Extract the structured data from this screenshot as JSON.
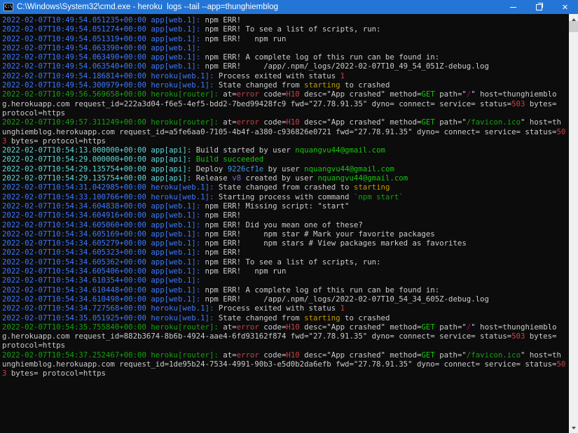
{
  "window": {
    "title": "C:\\Windows\\System32\\cmd.exe - heroku  logs --tail --app=thunghiemblog",
    "icon_text": "C:\\",
    "controls": {
      "minimize": "minimize",
      "restore": "restore-down",
      "close_glyph": "✕"
    }
  },
  "scrollbar": {
    "orientation": "vertical",
    "thumb_position": "top"
  },
  "palette": {
    "titlebar": "#2476D6",
    "background": "#0C0C0C",
    "fg": "#CCCCCC",
    "blue": "#3B78FF",
    "cyan": "#61D6D6",
    "green_dark": "#13A10E",
    "green_bright": "#16C60C",
    "red": "#CD3F45",
    "yellow": "#C19C00",
    "magenta": "#B4009E",
    "violet": "#875FD7",
    "deploy_blue": "#3A96DD",
    "scrollbar_track": "#F0F0F0",
    "scrollbar_thumb": "#CDCDCD"
  },
  "terminal": {
    "lines": [
      [
        [
          "2022-02-07T10:49:54.051235+00:00 ",
          "blue"
        ],
        [
          "app[web.1]:",
          "blue"
        ],
        [
          " npm ERR!",
          "fg"
        ]
      ],
      [
        [
          "2022-02-07T10:49:54.051274+00:00 ",
          "blue"
        ],
        [
          "app[web.1]:",
          "blue"
        ],
        [
          " npm ERR! To see a list of scripts, run:",
          "fg"
        ]
      ],
      [
        [
          "2022-02-07T10:49:54.051319+00:00 ",
          "blue"
        ],
        [
          "app[web.1]:",
          "blue"
        ],
        [
          " npm ERR!   npm run",
          "fg"
        ]
      ],
      [
        [
          "2022-02-07T10:49:54.063390+00:00 ",
          "blue"
        ],
        [
          "app[web.1]:",
          "blue"
        ]
      ],
      [
        [
          "2022-02-07T10:49:54.063490+00:00 ",
          "blue"
        ],
        [
          "app[web.1]:",
          "blue"
        ],
        [
          " npm ERR! A complete log of this run can be found in:",
          "fg"
        ]
      ],
      [
        [
          "2022-02-07T10:49:54.063540+00:00 ",
          "blue"
        ],
        [
          "app[web.1]:",
          "blue"
        ],
        [
          " npm ERR!     /app/.npm/_logs/2022-02-07T10_49_54_051Z-debug.log",
          "fg"
        ]
      ],
      [
        [
          "2022-02-07T10:49:54.186814+00:00 ",
          "blue"
        ],
        [
          "heroku[web.1]:",
          "blue"
        ],
        [
          " Process exited with status ",
          "fg"
        ],
        [
          "1",
          "red"
        ]
      ],
      [
        [
          "2022-02-07T10:49:54.300979+00:00 ",
          "blue"
        ],
        [
          "heroku[web.1]:",
          "blue"
        ],
        [
          " State changed from ",
          "fg"
        ],
        [
          "starting",
          "yellow"
        ],
        [
          " to crashed",
          "fg"
        ]
      ],
      [
        [
          "2022-02-07T10:49:56.569658+00:00 ",
          "green_dark"
        ],
        [
          "heroku[router]:",
          "green_dark"
        ],
        [
          " at=",
          "fg"
        ],
        [
          "error",
          "red"
        ],
        [
          " code=",
          "fg"
        ],
        [
          "H10",
          "red"
        ],
        [
          " desc=\"App crashed\" method=",
          "fg"
        ],
        [
          "GET",
          "green_bright"
        ],
        [
          " path=\"",
          "fg"
        ],
        [
          "/",
          "magenta"
        ],
        [
          "\" host=thunghiemblog.herokuapp.com request_id=222a3d04-f6e5-4ef5-bdd2-7bed99428fc9 fwd=\"27.78.91.35\" dyno= connect= service= status=",
          "fg"
        ],
        [
          "503",
          "red"
        ],
        [
          " bytes= protocol=https",
          "fg"
        ]
      ],
      [
        [
          "2022-02-07T10:49:57.311249+00:00 ",
          "green_dark"
        ],
        [
          "heroku[router]:",
          "green_dark"
        ],
        [
          " at=",
          "fg"
        ],
        [
          "error",
          "red"
        ],
        [
          " code=",
          "fg"
        ],
        [
          "H10",
          "red"
        ],
        [
          " desc=\"App crashed\" method=",
          "fg"
        ],
        [
          "GET",
          "green_bright"
        ],
        [
          " path=\"",
          "fg"
        ],
        [
          "/favicon.ico",
          "green_dark"
        ],
        [
          "\" host=thunghiemblog.herokuapp.com request_id=a5fe6aa0-7105-4b4f-a380-c936826e0721 fwd=\"27.78.91.35\" dyno= connect= service= status=",
          "fg"
        ],
        [
          "503",
          "red"
        ],
        [
          " bytes= protocol=https",
          "fg"
        ]
      ],
      [
        [
          "2022-02-07T10:54:13.000000+00:00 ",
          "cyan"
        ],
        [
          "app[api]:",
          "cyan"
        ],
        [
          " Build started by user ",
          "fg"
        ],
        [
          "nquangvu44@gmail.com",
          "green_bright"
        ]
      ],
      [
        [
          "2022-02-07T10:54:29.000000+00:00 ",
          "cyan"
        ],
        [
          "app[api]:",
          "cyan"
        ],
        [
          " ",
          "fg"
        ],
        [
          "Build succeeded",
          "green_bright"
        ]
      ],
      [
        [
          "2022-02-07T10:54:29.135754+00:00 ",
          "cyan"
        ],
        [
          "app[api]:",
          "cyan"
        ],
        [
          " Deploy ",
          "fg"
        ],
        [
          "9226cf1e",
          "deploy_blue"
        ],
        [
          " by user ",
          "fg"
        ],
        [
          "nquangvu44@gmail.com",
          "green_bright"
        ]
      ],
      [
        [
          "2022-02-07T10:54:29.135754+00:00 ",
          "cyan"
        ],
        [
          "app[api]:",
          "cyan"
        ],
        [
          " Release ",
          "fg"
        ],
        [
          "v8",
          "violet"
        ],
        [
          " created by user ",
          "fg"
        ],
        [
          "nquangvu44@gmail.com",
          "green_bright"
        ]
      ],
      [
        [
          "2022-02-07T10:54:31.042985+00:00 ",
          "blue"
        ],
        [
          "heroku[web.1]:",
          "blue"
        ],
        [
          " State changed from crashed to ",
          "fg"
        ],
        [
          "starting",
          "yellow"
        ]
      ],
      [
        [
          "2022-02-07T10:54:33.100766+00:00 ",
          "blue"
        ],
        [
          "heroku[web.1]:",
          "blue"
        ],
        [
          " Starting process with command ",
          "fg"
        ],
        [
          "`npm start`",
          "green_dark"
        ]
      ],
      [
        [
          "2022-02-07T10:54:34.604838+00:00 ",
          "blue"
        ],
        [
          "app[web.1]:",
          "blue"
        ],
        [
          " npm ERR! Missing script: \"start\"",
          "fg"
        ]
      ],
      [
        [
          "2022-02-07T10:54:34.604916+00:00 ",
          "blue"
        ],
        [
          "app[web.1]:",
          "blue"
        ],
        [
          " npm ERR!",
          "fg"
        ]
      ],
      [
        [
          "2022-02-07T10:54:34.605060+00:00 ",
          "blue"
        ],
        [
          "app[web.1]:",
          "blue"
        ],
        [
          " npm ERR! Did you mean one of these?",
          "fg"
        ]
      ],
      [
        [
          "2022-02-07T10:54:34.605169+00:00 ",
          "blue"
        ],
        [
          "app[web.1]:",
          "blue"
        ],
        [
          " npm ERR!     npm star # Mark your favorite packages",
          "fg"
        ]
      ],
      [
        [
          "2022-02-07T10:54:34.605279+00:00 ",
          "blue"
        ],
        [
          "app[web.1]:",
          "blue"
        ],
        [
          " npm ERR!     npm stars # View packages marked as favorites",
          "fg"
        ]
      ],
      [
        [
          "2022-02-07T10:54:34.605323+00:00 ",
          "blue"
        ],
        [
          "app[web.1]:",
          "blue"
        ],
        [
          " npm ERR!",
          "fg"
        ]
      ],
      [
        [
          "2022-02-07T10:54:34.605362+00:00 ",
          "blue"
        ],
        [
          "app[web.1]:",
          "blue"
        ],
        [
          " npm ERR! To see a list of scripts, run:",
          "fg"
        ]
      ],
      [
        [
          "2022-02-07T10:54:34.605406+00:00 ",
          "blue"
        ],
        [
          "app[web.1]:",
          "blue"
        ],
        [
          " npm ERR!   npm run",
          "fg"
        ]
      ],
      [
        [
          "2022-02-07T10:54:34.610354+00:00 ",
          "blue"
        ],
        [
          "app[web.1]:",
          "blue"
        ]
      ],
      [
        [
          "2022-02-07T10:54:34.610448+00:00 ",
          "blue"
        ],
        [
          "app[web.1]:",
          "blue"
        ],
        [
          " npm ERR! A complete log of this run can be found in:",
          "fg"
        ]
      ],
      [
        [
          "2022-02-07T10:54:34.610498+00:00 ",
          "blue"
        ],
        [
          "app[web.1]:",
          "blue"
        ],
        [
          " npm ERR!     /app/.npm/_logs/2022-02-07T10_54_34_605Z-debug.log",
          "fg"
        ]
      ],
      [
        [
          "2022-02-07T10:54:34.727568+00:00 ",
          "blue"
        ],
        [
          "heroku[web.1]:",
          "blue"
        ],
        [
          " Process exited with status ",
          "fg"
        ],
        [
          "1",
          "red"
        ]
      ],
      [
        [
          "2022-02-07T10:54:35.051925+00:00 ",
          "blue"
        ],
        [
          "heroku[web.1]:",
          "blue"
        ],
        [
          " State changed from ",
          "fg"
        ],
        [
          "starting",
          "yellow"
        ],
        [
          " to crashed",
          "fg"
        ]
      ],
      [
        [
          "2022-02-07T10:54:35.755840+00:00 ",
          "green_dark"
        ],
        [
          "heroku[router]:",
          "green_dark"
        ],
        [
          " at=",
          "fg"
        ],
        [
          "error",
          "red"
        ],
        [
          " code=",
          "fg"
        ],
        [
          "H10",
          "red"
        ],
        [
          " desc=\"App crashed\" method=",
          "fg"
        ],
        [
          "GET",
          "green_bright"
        ],
        [
          " path=\"",
          "fg"
        ],
        [
          "/",
          "magenta"
        ],
        [
          "\" host=thunghiemblog.herokuapp.com request_id=882b3674-8b6b-4924-aae4-6fd93162f874 fwd=\"27.78.91.35\" dyno= connect= service= status=",
          "fg"
        ],
        [
          "503",
          "red"
        ],
        [
          " bytes= protocol=https",
          "fg"
        ]
      ],
      [
        [
          "2022-02-07T10:54:37.252467+00:00 ",
          "green_dark"
        ],
        [
          "heroku[router]:",
          "green_dark"
        ],
        [
          " at=",
          "fg"
        ],
        [
          "error",
          "red"
        ],
        [
          " code=",
          "fg"
        ],
        [
          "H10",
          "red"
        ],
        [
          " desc=\"App crashed\" method=",
          "fg"
        ],
        [
          "GET",
          "green_bright"
        ],
        [
          " path=\"",
          "fg"
        ],
        [
          "/favicon.ico",
          "green_dark"
        ],
        [
          "\" host=thunghiemblog.herokuapp.com request_id=1de95b24-7534-4991-90b3-e5d0b2da6efb fwd=\"27.78.91.35\" dyno= connect= service= status=",
          "fg"
        ],
        [
          "503",
          "red"
        ],
        [
          " bytes= protocol=https",
          "fg"
        ]
      ]
    ]
  }
}
